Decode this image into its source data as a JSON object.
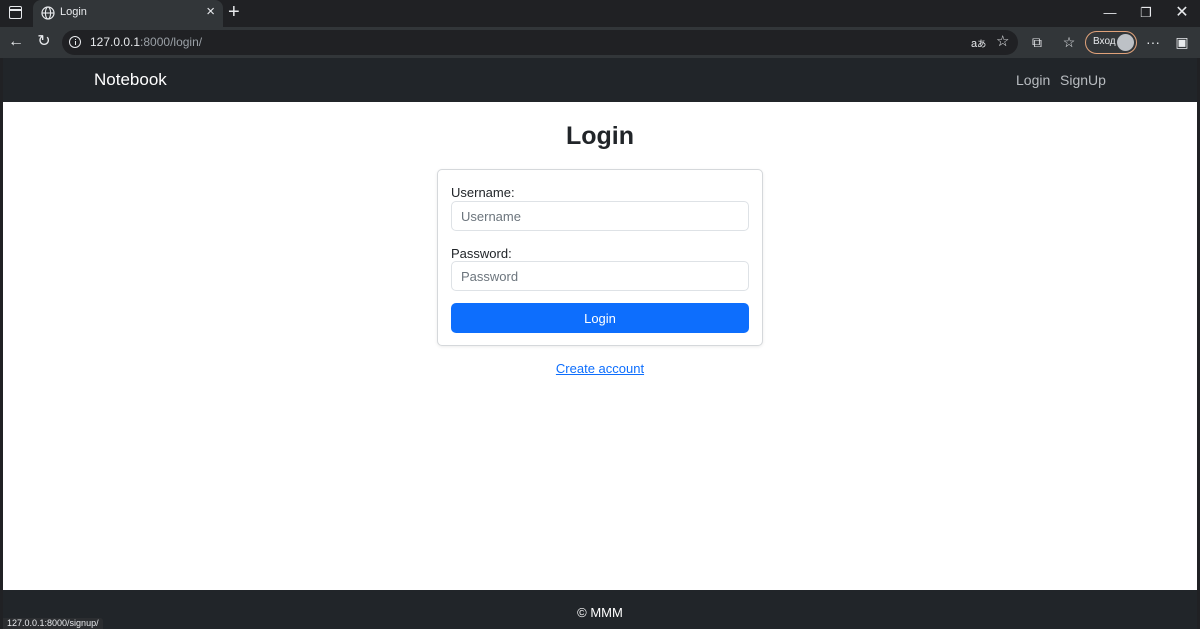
{
  "browser": {
    "tab_title": "Login",
    "url_host": "127.0.0.1",
    "url_rest": ":8000/login/",
    "signin_label": "Вход",
    "status_url": "127.0.0.1:8000/signup/"
  },
  "navbar": {
    "brand": "Notebook",
    "links": [
      "Login",
      "SignUp"
    ]
  },
  "main": {
    "heading": "Login",
    "username_label": "Username:",
    "username_placeholder": "Username",
    "password_label": "Password:",
    "password_placeholder": "Password",
    "submit_label": "Login",
    "create_account": "Create account"
  },
  "footer": {
    "text": "© MMM"
  },
  "colors": {
    "primary": "#0d6efd",
    "navbar_bg": "#212529"
  }
}
